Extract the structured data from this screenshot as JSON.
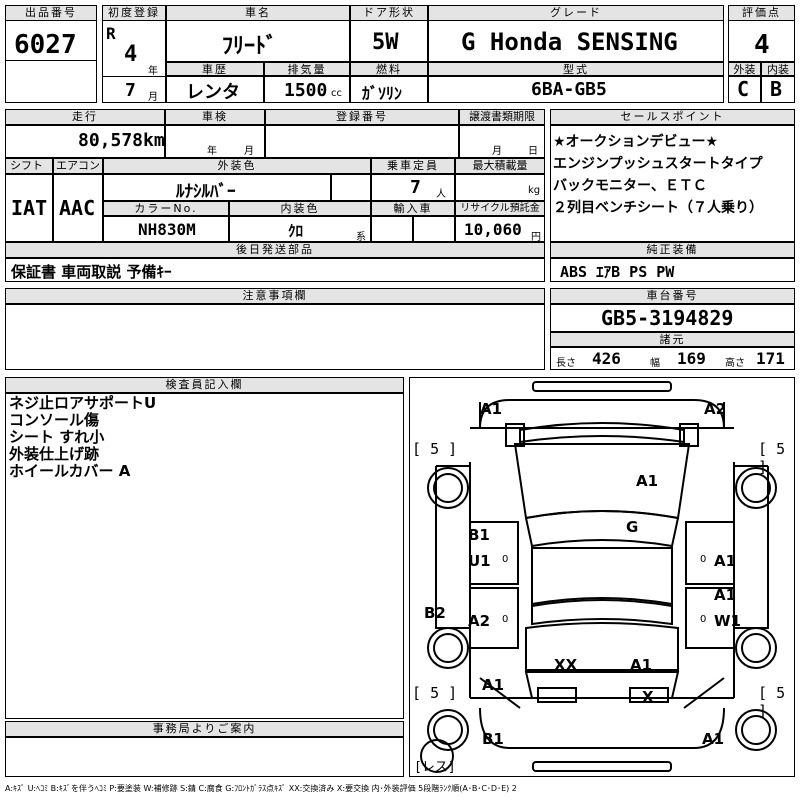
{
  "header": {
    "lot_label": "出品番号",
    "lot_number": "6027",
    "first_reg_label": "初度登録",
    "era": "R",
    "year": "4",
    "year_unit": "年",
    "month": "7",
    "month_unit": "月",
    "car_name_label": "車名",
    "car_name": "ﾌﾘｰﾄﾞ",
    "door_label": "ドア形状",
    "door": "5W",
    "grade_label": "グレード",
    "grade": "G Honda SENSING",
    "score_label": "評価点",
    "score": "4",
    "history_label": "車歴",
    "history": "レンタ",
    "displacement_label": "排気量",
    "displacement": "1500",
    "displacement_unit": "cc",
    "fuel_label": "燃料",
    "fuel": "ｶﾞｿﾘﾝ",
    "model_label": "型式",
    "model": "6BA-GB5",
    "exterior_label": "外装",
    "exterior": "C",
    "interior_label": "内装",
    "interior": "B"
  },
  "row2": {
    "mileage_label": "走行",
    "mileage": "80,578",
    "mileage_unit": "km",
    "inspection_label": "車検",
    "inspection_year": "年",
    "inspection_month": "月",
    "reg_no_label": "登録番号",
    "transfer_label": "譲渡書類期限",
    "transfer_month": "月",
    "transfer_day": "日",
    "shift_label": "シフト",
    "shift": "IAT",
    "ac_label": "エアコン",
    "ac": "AAC",
    "color_label": "外装色",
    "color": "ﾙﾅｼﾙﾊﾞｰ",
    "capacity_label": "乗車定員",
    "capacity": "7",
    "capacity_unit": "人",
    "max_load_label": "最大積載量",
    "max_load_unit": "kg",
    "color_no_label": "カラーNo.",
    "color_no": "NH830M",
    "interior_color_label": "内装色",
    "interior_color": "ｸﾛ",
    "interior_color_unit": "系",
    "import_label": "輸入車",
    "recycle_label": "リサイクル預託金",
    "recycle": "10,060",
    "recycle_unit": "円"
  },
  "sales_points": {
    "label": "セールスポイント",
    "items": [
      "★オークションデビュー★",
      "エンジンプッシュスタートタイプ",
      "バックモニター、ＥＴＣ",
      "２列目ベンチシート（７人乗り）"
    ]
  },
  "accessories": {
    "label": "後日発送部品",
    "value": "保証書 車両取説 予備ｷｰ"
  },
  "equipment": {
    "label": "純正装備",
    "value": "ABS ｴｱB PS PW"
  },
  "notes": {
    "label": "注意事項欄"
  },
  "chassis": {
    "label": "車台番号",
    "value": "GB5-3194829"
  },
  "dimensions": {
    "label": "諸元",
    "length_label": "長さ",
    "length": "426",
    "width_label": "幅",
    "width": "169",
    "height_label": "高さ",
    "height": "171"
  },
  "inspector": {
    "label": "検査員記入欄",
    "lines": [
      "ネジ止ロアサポートU",
      "コンソール傷",
      "シート すれ小",
      "外装仕上げ跡",
      "ホイールカバー A"
    ]
  },
  "office": {
    "label": "事務局よりご案内"
  },
  "diagram": {
    "front_left": "A1",
    "front_right": "A2",
    "tire_fl": "5",
    "tire_fr": "5",
    "tire_rl": "5",
    "tire_rr": "5",
    "hood": "A1",
    "windshield": "G",
    "left_front_door_1": "B1",
    "left_front_door_2": "U1",
    "left_front_door_mark": "0",
    "right_front_door": "A1",
    "right_front_door_mark": "0",
    "left_rear_fender": "B2",
    "left_rear_door": "A2",
    "left_rear_door_mark": "0",
    "right_rear_door_1": "A1",
    "right_rear_door_2": "W1",
    "right_rear_door_mark": "0",
    "roof_rear": "XX",
    "rear_glass": "A1",
    "left_quarter": "A1",
    "rear_center": "X",
    "rear_left": "B1",
    "rear_right": "A1",
    "spare": "レス"
  },
  "legend": "A:ｷｽﾞ U:ﾍｺﾐ B:ｷｽﾞを伴うﾍｺﾐ P:要塗装 W:補修跡 S:錆 C:腐食 G:ﾌﾛﾝﾄｶﾞﾗｽ点ｷｽﾞ XX:交換済み X:要交換 内･外装評価 5段階ﾗﾝｸ順(A･B･C･D･E) 2"
}
